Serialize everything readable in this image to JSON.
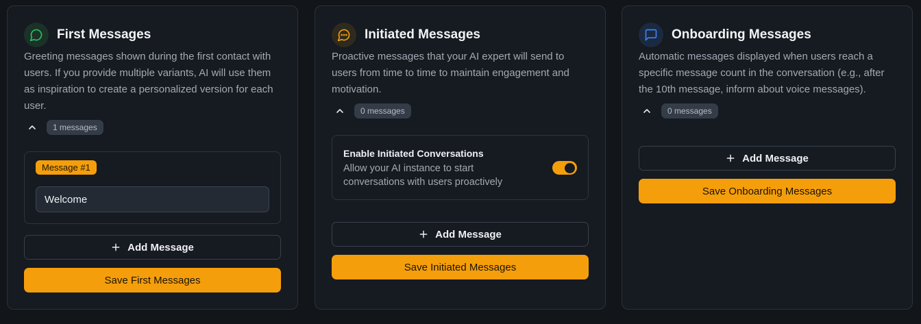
{
  "cards": [
    {
      "title": "First Messages",
      "icon": "chat-bubble-icon",
      "accent": "#22c55e",
      "description": "Greeting messages shown during the first contact with users. If you provide multiple variants, AI will use them as inspiration to create a personalized version for each user.",
      "count_label": "1 messages",
      "messages": [
        {
          "tag": "Message #1",
          "value": "Welcome"
        }
      ],
      "add_label": "Add Message",
      "save_label": "Save First Messages"
    },
    {
      "title": "Initiated Messages",
      "icon": "chat-dots-icon",
      "accent": "#f59e0b",
      "description": "Proactive messages that your AI expert will send to users from time to time to maintain engagement and motivation.",
      "count_label": "0 messages",
      "toggle": {
        "title": "Enable Initiated Conversations",
        "description": "Allow your AI instance to start conversations with users proactively",
        "enabled": true
      },
      "add_label": "Add Message",
      "save_label": "Save Initiated Messages"
    },
    {
      "title": "Onboarding Messages",
      "icon": "message-square-icon",
      "accent": "#3b82f6",
      "description": "Automatic messages displayed when users reach a specific message count in the conversation (e.g., after the 10th message, inform about voice messages).",
      "count_label": "0 messages",
      "add_label": "Add Message",
      "save_label": "Save Onboarding Messages"
    }
  ]
}
